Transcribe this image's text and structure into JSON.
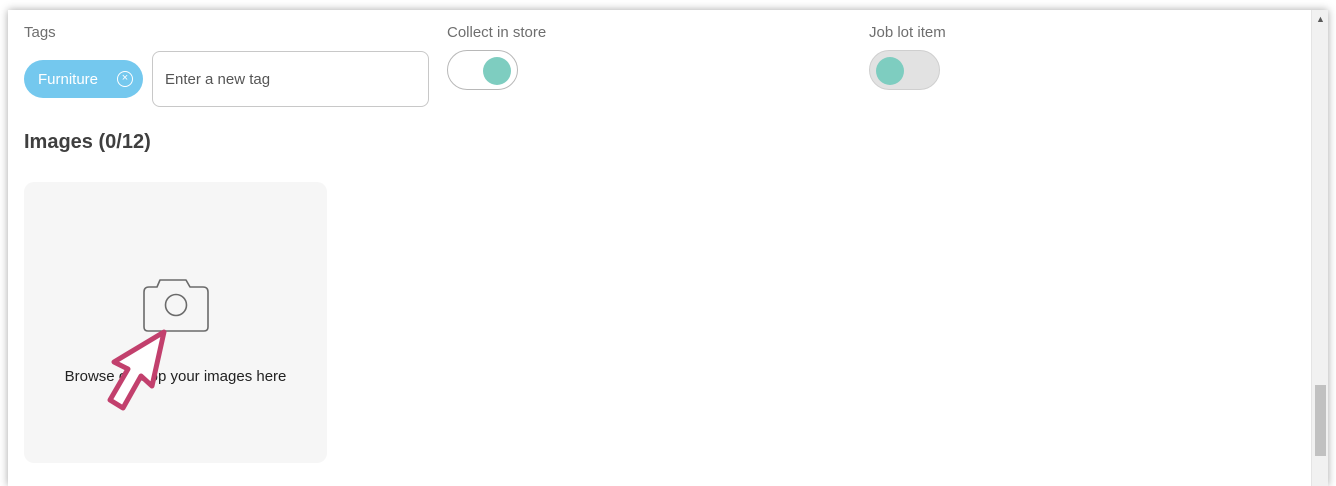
{
  "tags": {
    "label": "Tags",
    "chip_label": "Furniture",
    "chip_remove": "×",
    "input_placeholder": "Enter a new tag"
  },
  "collect_in_store": {
    "label": "Collect in store",
    "enabled": true
  },
  "job_lot_item": {
    "label": "Job lot item",
    "enabled": false
  },
  "images": {
    "title": "Images (0/12)",
    "dropzone_text": "Browse or drop your images here"
  },
  "scrollbar": {
    "up_arrow": "▲"
  },
  "colors": {
    "chip_bg": "#74c8ee",
    "toggle_knob": "#7ecdc0",
    "cursor": "#c2406d",
    "dropzone_bg": "#f6f6f6"
  }
}
